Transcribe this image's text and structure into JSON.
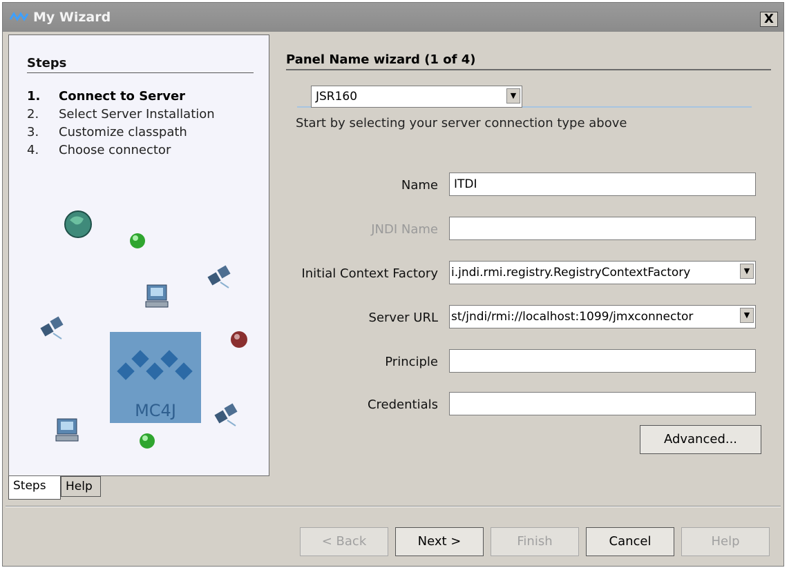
{
  "window": {
    "title": "My Wizard",
    "close_label": "X"
  },
  "steps_panel": {
    "heading": "Steps",
    "items": [
      {
        "num": "1.",
        "label": "Connect to Server",
        "active": true
      },
      {
        "num": "2.",
        "label": "Select Server Installation",
        "active": false
      },
      {
        "num": "3.",
        "label": "Customize classpath",
        "active": false
      },
      {
        "num": "4.",
        "label": "Choose connector",
        "active": false
      }
    ],
    "logo_text": "MC4J"
  },
  "tabs": [
    {
      "label": "Steps",
      "selected": true
    },
    {
      "label": "Help",
      "selected": false
    }
  ],
  "main": {
    "title": "Panel Name wizard (1 of 4)",
    "connection_type": {
      "value": "JSR160"
    },
    "hint": "Start by selecting your server connection type above",
    "fields": {
      "name": {
        "label": "Name",
        "value": "ITDI"
      },
      "jndi_name": {
        "label": "JNDI Name",
        "value": ""
      },
      "initial_context_factory": {
        "label": "Initial Context Factory",
        "value": "i.jndi.rmi.registry.RegistryContextFactory"
      },
      "server_url": {
        "label": "Server URL",
        "value": "st/jndi/rmi://localhost:1099/jmxconnector"
      },
      "principle": {
        "label": "Principle",
        "value": ""
      },
      "credentials": {
        "label": "Credentials",
        "value": ""
      }
    },
    "advanced_label": "Advanced..."
  },
  "footer": {
    "back": "< Back",
    "next": "Next >",
    "finish": "Finish",
    "cancel": "Cancel",
    "help": "Help"
  },
  "colors": {
    "title_bar": "#8b8b8b",
    "dialog_bg": "#d4d0c8",
    "steps_bg": "#f4f4fb",
    "logo_bg": "#6d9cc6",
    "logo_diamond": "#2c6aa6"
  }
}
